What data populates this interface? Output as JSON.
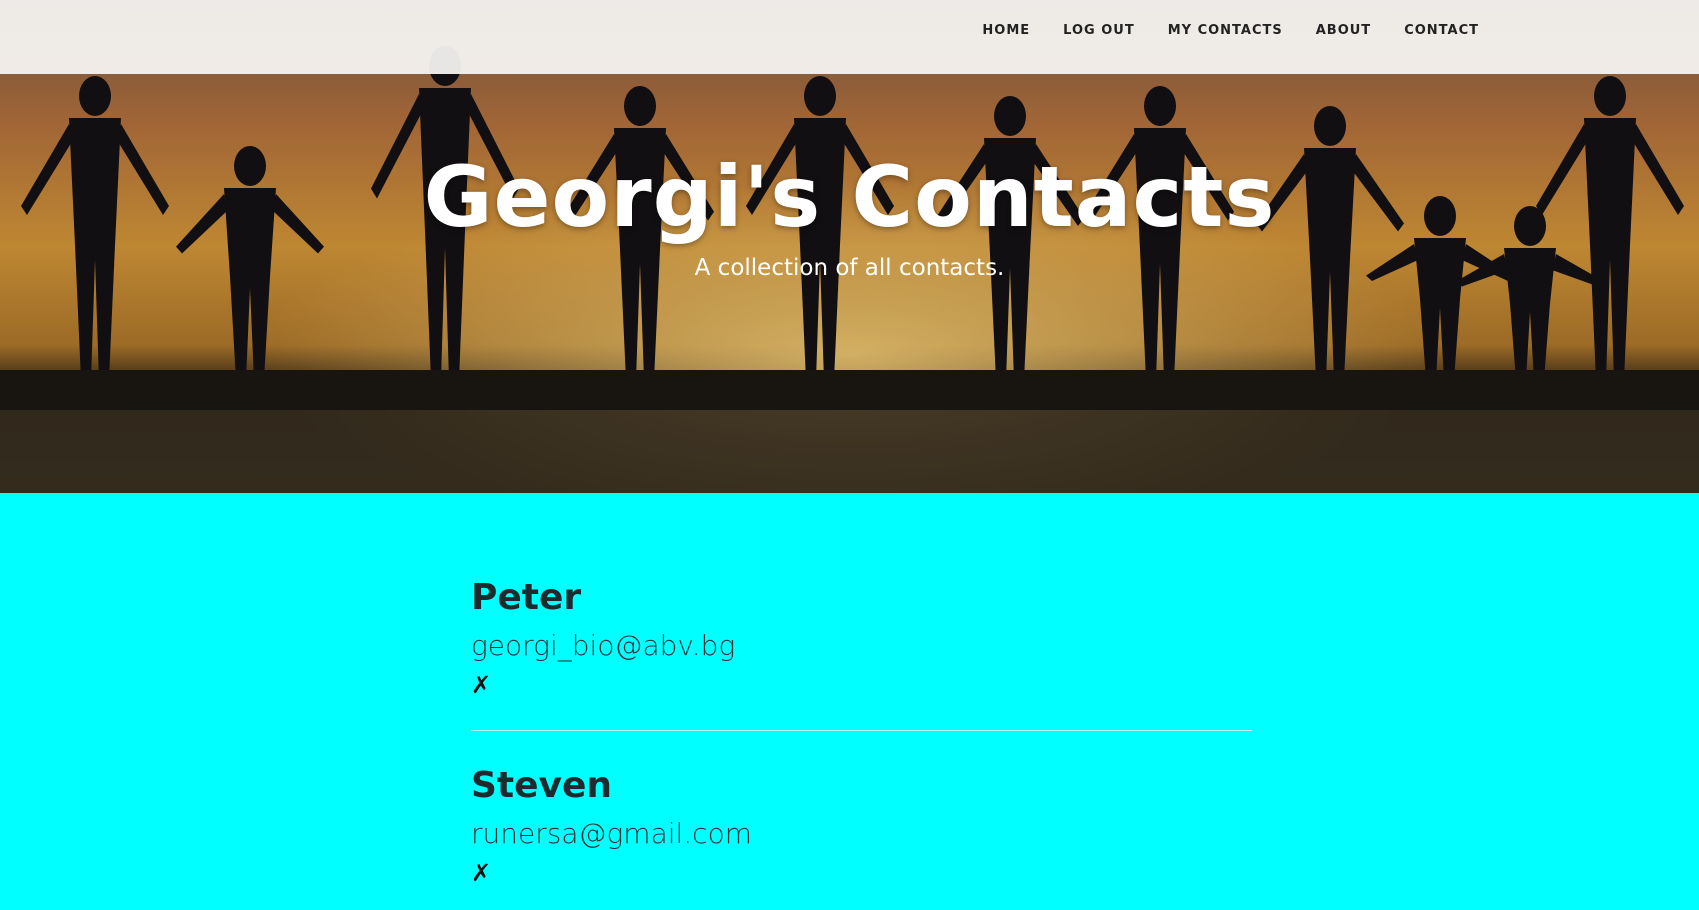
{
  "nav": {
    "items": [
      {
        "label": "HOME"
      },
      {
        "label": "LOG OUT"
      },
      {
        "label": "MY CONTACTS"
      },
      {
        "label": "ABOUT"
      },
      {
        "label": "CONTACT"
      }
    ]
  },
  "hero": {
    "title": "Georgi's Contacts",
    "subtitle": "A collection of all contacts."
  },
  "contacts": [
    {
      "name": "Peter",
      "email": "georgi_bio@abv.bg",
      "delete_glyph": "✗",
      "delete_icon": "delete-icon"
    },
    {
      "name": "Steven",
      "email": "runersa@gmail.com",
      "delete_glyph": "✗",
      "delete_icon": "delete-icon"
    }
  ],
  "colors": {
    "content_background": "#00ffff",
    "navbar_background": "#f8f6f4",
    "text_dark": "#1e2a2d"
  }
}
